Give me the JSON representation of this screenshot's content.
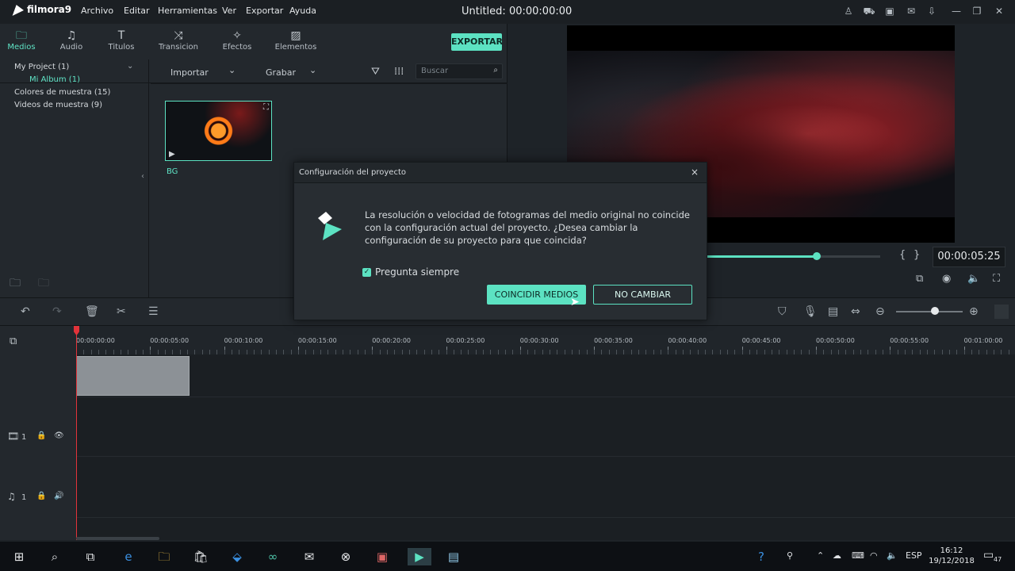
{
  "app": {
    "logo": "filmora9",
    "menu": [
      "Archivo",
      "Editar",
      "Herramientas",
      "Ver",
      "Exportar",
      "Ayuda"
    ],
    "title": "Untitled:",
    "title_time": "00:00:00:00"
  },
  "tabs": [
    {
      "label": "Medios",
      "icon": "folder-icon"
    },
    {
      "label": "Audio",
      "icon": "music-note-icon"
    },
    {
      "label": "Titulos",
      "icon": "text-icon"
    },
    {
      "label": "Transicion",
      "icon": "transition-icon"
    },
    {
      "label": "Efectos",
      "icon": "effects-icon"
    },
    {
      "label": "Elementos",
      "icon": "elements-icon"
    }
  ],
  "export_label": "EXPORTAR",
  "tree": {
    "project": "My Project (1)",
    "album": "Mi Album (1)",
    "colors": "Colores de muestra (15)",
    "videos": "Videos de muestra (9)"
  },
  "mediabar": {
    "import": "Importar",
    "record": "Grabar",
    "search_placeholder": "Buscar"
  },
  "media": {
    "name": "BG"
  },
  "preview": {
    "timecode": "00:00:05:25",
    "progress": 0.65
  },
  "ruler": [
    "00:00:00:00",
    "00:00:05:00",
    "00:00:10:00",
    "00:00:15:00",
    "00:00:20:00",
    "00:00:25:00",
    "00:00:30:00",
    "00:00:35:00",
    "00:00:40:00",
    "00:00:45:00",
    "00:00:50:00",
    "00:00:55:00",
    "00:01:00:00"
  ],
  "tracks": {
    "video_num": "1",
    "audio_num": "1"
  },
  "dialog": {
    "title": "Configuración del proyecto",
    "close": "×",
    "message": "La resolución o velocidad de fotogramas del medio original no coincide con la configuración actual del proyecto. ¿Desea cambiar la configuración de su proyecto para que coincida?",
    "checkbox_label": "Pregunta siempre",
    "checkbox_checked": true,
    "match_button": "COINCIDIR MEDIOS",
    "keep_button": "NO CAMBIAR"
  },
  "taskbar": {
    "lang": "ESP",
    "time": "16:12",
    "date": "19/12/2018",
    "notif_count": "47"
  },
  "colors": {
    "accent": "#5ce2c2",
    "playhead": "#e2333a"
  }
}
